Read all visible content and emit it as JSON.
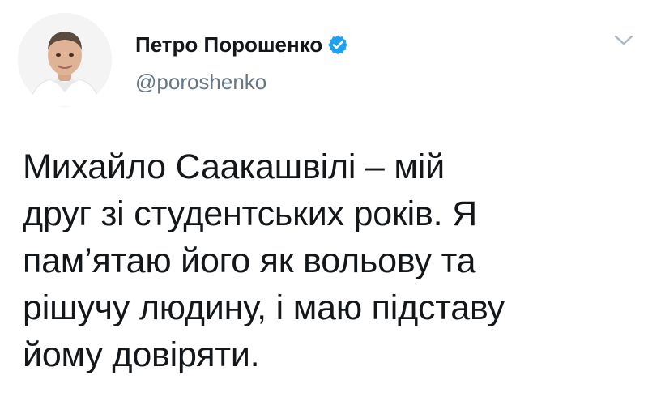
{
  "user": {
    "display_name": "Петро Порошенко",
    "handle": "@poroshenko",
    "verified": true,
    "avatar_icon": "profile-photo"
  },
  "menu": {
    "icon": "chevron-down-icon"
  },
  "tweet": {
    "lines": [
      "Михайло Саакашвілі – мій",
      "друг зі студентських років. Я",
      "пам’ятаю його як вольову та",
      "рішучу людину, і маю підставу",
      "йому довіряти."
    ]
  },
  "colors": {
    "background": "#ffffff",
    "text": "#14171a",
    "secondary_text": "#657786",
    "verified_blue": "#1da1f2",
    "chevron": "#aab8c2"
  }
}
